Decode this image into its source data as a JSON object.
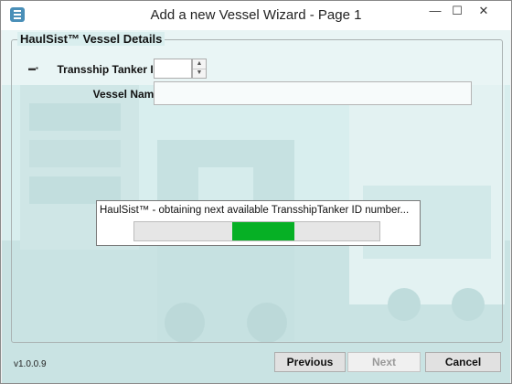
{
  "window": {
    "title": "Add a new Vessel Wizard - Page 1",
    "minimize_glyph": "—",
    "maximize_glyph": "☐",
    "close_glyph": "✕"
  },
  "group": {
    "legend": "HaulSist™ Vessel Details",
    "icon_text": "▬▪",
    "fields": {
      "tanker_id_label": "Transship Tanker Id",
      "tanker_id_value": "",
      "vessel_name_label": "Vessel Name",
      "vessel_name_value": ""
    }
  },
  "progress": {
    "message": "HaulSist™ - obtaining next available TransshipTanker ID number...",
    "state": "indeterminate",
    "color": "#06b025"
  },
  "footer": {
    "version": "v1.0.0.9",
    "previous_label": "Previous",
    "next_label": "Next",
    "cancel_label": "Cancel"
  },
  "icons": {
    "app": "app-icon",
    "spin_up": "chevron-up-icon",
    "spin_down": "chevron-down-icon"
  }
}
